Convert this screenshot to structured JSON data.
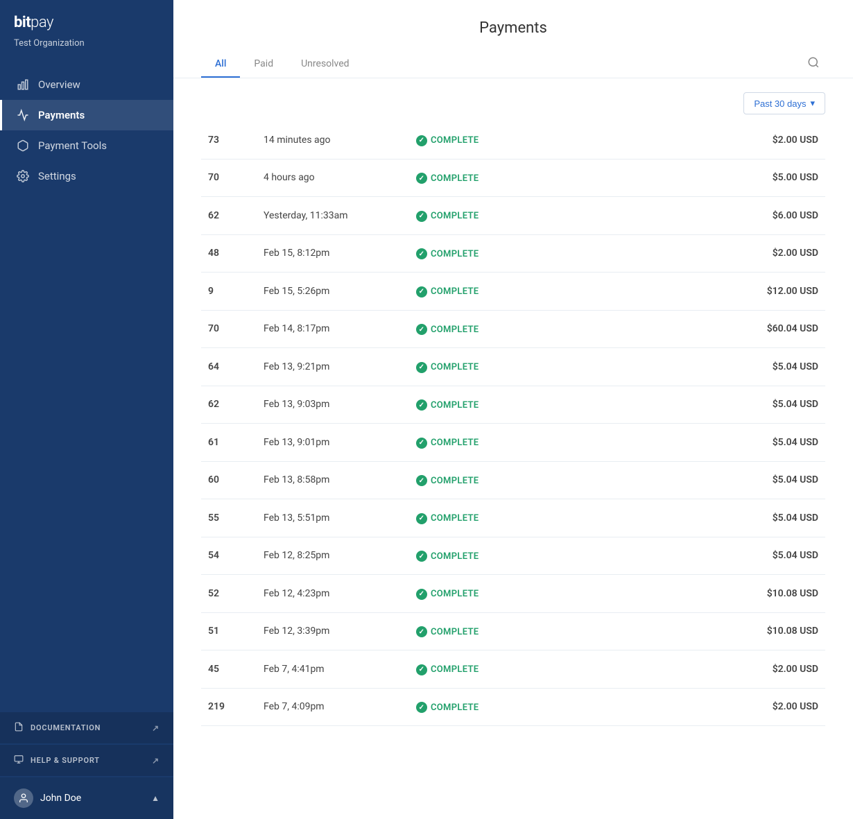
{
  "app": {
    "logo": "bitpay",
    "org": "Test Organization"
  },
  "sidebar": {
    "nav_items": [
      {
        "id": "overview",
        "label": "Overview",
        "icon": "bar-chart",
        "active": false
      },
      {
        "id": "payments",
        "label": "Payments",
        "icon": "activity",
        "active": true
      },
      {
        "id": "payment-tools",
        "label": "Payment Tools",
        "icon": "box",
        "active": false
      },
      {
        "id": "settings",
        "label": "Settings",
        "icon": "gear",
        "active": false
      }
    ],
    "links": [
      {
        "id": "documentation",
        "label": "DOCUMENTATION",
        "icon": "doc"
      },
      {
        "id": "help-support",
        "label": "HELP & SUPPORT",
        "icon": "help"
      }
    ],
    "user": {
      "name": "John Doe",
      "chevron": "▲"
    }
  },
  "header": {
    "title": "Payments",
    "tabs": [
      {
        "id": "all",
        "label": "All",
        "active": true
      },
      {
        "id": "paid",
        "label": "Paid",
        "active": false
      },
      {
        "id": "unresolved",
        "label": "Unresolved",
        "active": false
      }
    ]
  },
  "filter": {
    "label": "Past 30 days",
    "chevron": "▾"
  },
  "payments": [
    {
      "id": "73",
      "time": "14 minutes ago",
      "status": "COMPLETE",
      "amount": "$2.00 USD"
    },
    {
      "id": "70",
      "time": "4 hours ago",
      "status": "COMPLETE",
      "amount": "$5.00 USD"
    },
    {
      "id": "62",
      "time": "Yesterday, 11:33am",
      "status": "COMPLETE",
      "amount": "$6.00 USD"
    },
    {
      "id": "48",
      "time": "Feb 15, 8:12pm",
      "status": "COMPLETE",
      "amount": "$2.00 USD"
    },
    {
      "id": "9",
      "time": "Feb 15, 5:26pm",
      "status": "COMPLETE",
      "amount": "$12.00 USD"
    },
    {
      "id": "70",
      "time": "Feb 14, 8:17pm",
      "status": "COMPLETE",
      "amount": "$60.04 USD"
    },
    {
      "id": "64",
      "time": "Feb 13, 9:21pm",
      "status": "COMPLETE",
      "amount": "$5.04 USD"
    },
    {
      "id": "62",
      "time": "Feb 13, 9:03pm",
      "status": "COMPLETE",
      "amount": "$5.04 USD"
    },
    {
      "id": "61",
      "time": "Feb 13, 9:01pm",
      "status": "COMPLETE",
      "amount": "$5.04 USD"
    },
    {
      "id": "60",
      "time": "Feb 13, 8:58pm",
      "status": "COMPLETE",
      "amount": "$5.04 USD"
    },
    {
      "id": "55",
      "time": "Feb 13, 5:51pm",
      "status": "COMPLETE",
      "amount": "$5.04 USD"
    },
    {
      "id": "54",
      "time": "Feb 12, 8:25pm",
      "status": "COMPLETE",
      "amount": "$5.04 USD"
    },
    {
      "id": "52",
      "time": "Feb 12, 4:23pm",
      "status": "COMPLETE",
      "amount": "$10.08 USD"
    },
    {
      "id": "51",
      "time": "Feb 12, 3:39pm",
      "status": "COMPLETE",
      "amount": "$10.08 USD"
    },
    {
      "id": "45",
      "time": "Feb 7, 4:41pm",
      "status": "COMPLETE",
      "amount": "$2.00 USD"
    },
    {
      "id": "219",
      "time": "Feb 7, 4:09pm",
      "status": "COMPLETE",
      "amount": "$2.00 USD"
    }
  ],
  "status": {
    "complete_label": "COMPLETE",
    "check_icon": "✓"
  }
}
